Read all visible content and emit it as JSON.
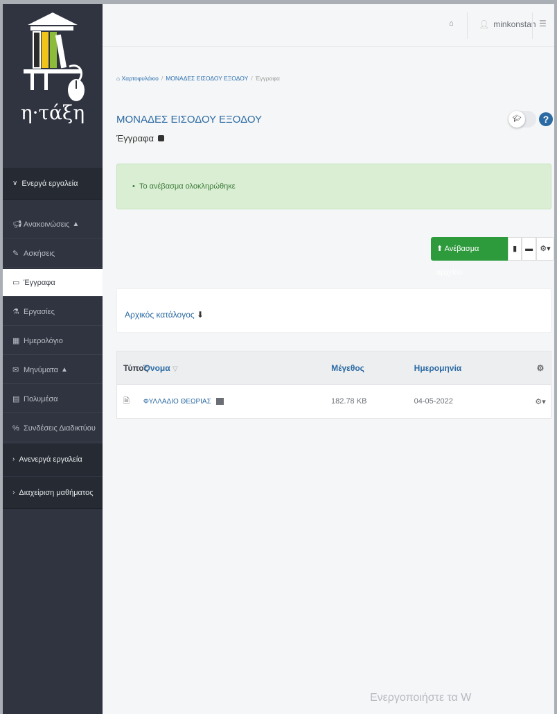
{
  "header": {
    "username": "minkonstan"
  },
  "logo": {
    "text": "η·τάξη"
  },
  "sidebar": {
    "sections": [
      {
        "label": "Ενεργά εργαλεία",
        "chevron": "∨"
      },
      {
        "label": "Ανενεργά εργαλεία",
        "chevron": "›"
      },
      {
        "label": "Διαχείριση μαθήματος",
        "chevron": "›"
      }
    ],
    "items": [
      {
        "label": "Ανακοινώσεις",
        "icon": "megaphone-icon",
        "warning": true
      },
      {
        "label": "Ασκήσεις",
        "icon": "edit-icon"
      },
      {
        "label": "Έγγραφα",
        "icon": "folder-open-icon",
        "active": true
      },
      {
        "label": "Εργασίες",
        "icon": "flask-icon"
      },
      {
        "label": "Ημερολόγιο",
        "icon": "calendar-icon"
      },
      {
        "label": "Μηνύματα",
        "icon": "envelope-icon",
        "warning": true
      },
      {
        "label": "Πολυμέσα",
        "icon": "film-icon"
      },
      {
        "label": "Συνδέσεις Διαδικτύου",
        "icon": "link-icon"
      }
    ]
  },
  "breadcrumb": {
    "home": "Χαρτοφυλάκιο",
    "course": "ΜΟΝΑΔΕΣ ΕΙΣΟΔΟΥ ΕΞΟΔΟΥ",
    "current": "Έγγραφα"
  },
  "page": {
    "title": "ΜΟΝΑΔΕΣ ΕΙΣΟΔΟΥ ΕΞΟΔΟΥ",
    "subtitle": "Έγγραφα"
  },
  "alert": {
    "message": "Το ανέβασμα ολοκληρώθηκε"
  },
  "toolbar": {
    "upload_label": "Ανέβασμα αρχείου"
  },
  "root_folder": {
    "label": "Αρχικός κατάλογος"
  },
  "table": {
    "headers": {
      "type": "Τύπος",
      "name": "Όνομα",
      "size": "Μέγεθος",
      "date": "Ημερομηνία"
    },
    "rows": [
      {
        "name": "ΦΥΛΛΑΔΙΟ ΘΕΩΡΙΑΣ",
        "size": "182.78 KB",
        "date": "04-05-2022"
      }
    ]
  },
  "watermark": "Ενεργοποιήστε τα W",
  "colors": {
    "sidebar": "#2f3440",
    "accent": "#2b6aa3",
    "success": "#2d9a3c",
    "alert_bg": "#d9eed3"
  }
}
